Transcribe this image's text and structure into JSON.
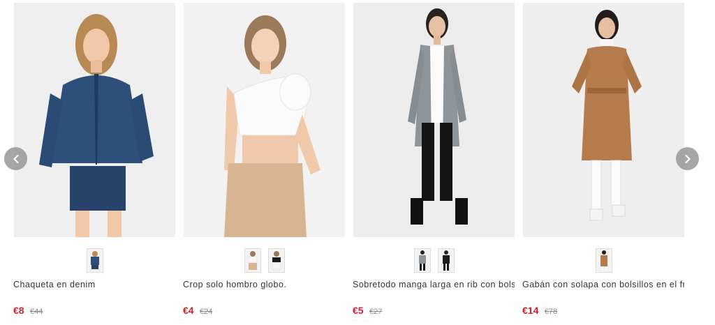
{
  "products": [
    {
      "name": "Chaqueta en denim",
      "price": "€8",
      "old_price": "€44",
      "image_icon": "model-denim-jacket-icon",
      "swatches": [
        "denim-blue"
      ]
    },
    {
      "name": "Crop solo hombro globo.",
      "price": "€4",
      "old_price": "€24",
      "image_icon": "model-one-shoulder-crop-icon",
      "swatches": [
        "white",
        "black"
      ]
    },
    {
      "name": "Sobretodo manga larga en rib con bolsill",
      "price": "€5",
      "old_price": "€27",
      "image_icon": "model-grey-cardigan-icon",
      "swatches": [
        "grey",
        "black"
      ]
    },
    {
      "name": "Gabán con solapa con bolsillos en el fre",
      "price": "€14",
      "old_price": "€78",
      "image_icon": "model-camel-coat-icon",
      "swatches": [
        "camel"
      ]
    }
  ],
  "navigation": {
    "prev_icon": "chevron-left-icon",
    "next_icon": "chevron-right-icon"
  },
  "colors": {
    "sale_price": "#d0202e",
    "old_price": "#888888",
    "text": "#333333",
    "arrow_bg": "#969696"
  }
}
